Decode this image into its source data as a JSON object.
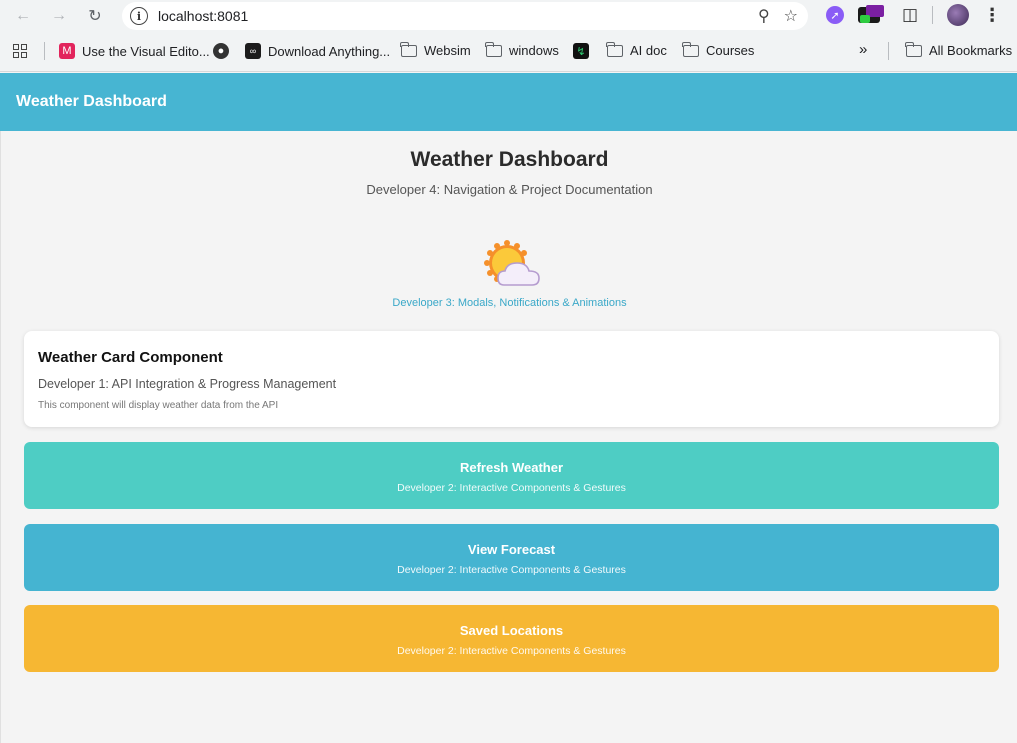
{
  "browser": {
    "url": "localhost:8081",
    "bookmarks": [
      {
        "label": "Use the Visual Edito...",
        "icon": "visual-editor-icon"
      },
      {
        "label": "Download Anything...",
        "icon": "download-site-icon"
      },
      {
        "label": "Websim",
        "icon": "folder-icon"
      },
      {
        "label": "windows",
        "icon": "folder-icon"
      },
      {
        "label": "AI doc",
        "icon": "folder-icon"
      },
      {
        "label": "Courses",
        "icon": "folder-icon"
      }
    ],
    "more_label": "»",
    "all_bookmarks_label": "All Bookmarks"
  },
  "header": {
    "title": "Weather Dashboard"
  },
  "main": {
    "title": "Weather Dashboard",
    "subtitle": "Developer 4: Navigation & Project Documentation",
    "animation_caption": "Developer 3: Modals, Notifications & Animations",
    "weather_icon": "sun-behind-cloud-icon",
    "card": {
      "title": "Weather Card Component",
      "subtitle": "Developer 1: API Integration & Progress Management",
      "note": "This component will display weather data from the API"
    },
    "actions": [
      {
        "label": "Refresh Weather",
        "sub": "Developer 2: Interactive Components & Gestures",
        "color": "#4ecdc4"
      },
      {
        "label": "View Forecast",
        "sub": "Developer 2: Interactive Components & Gestures",
        "color": "#45b4d1"
      },
      {
        "label": "Saved Locations",
        "sub": "Developer 2: Interactive Components & Gestures",
        "color": "#f6b733"
      }
    ]
  },
  "colors": {
    "header_bg": "#47b5d2",
    "accent_text": "#3aa8c8",
    "page_bg": "#f4f4f4"
  }
}
